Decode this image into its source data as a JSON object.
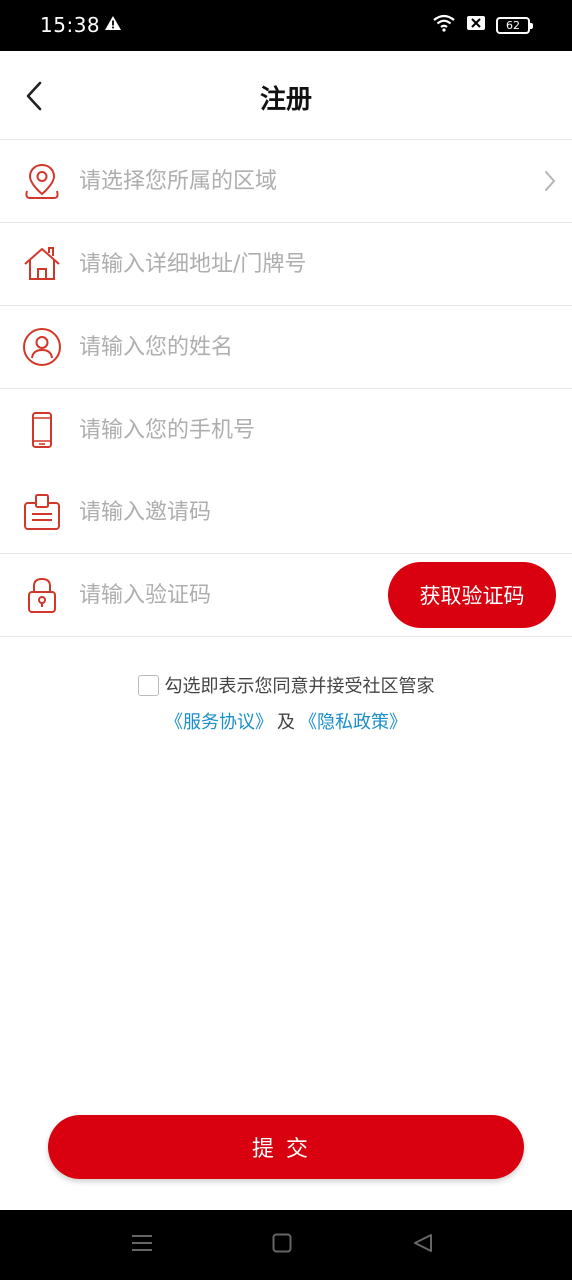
{
  "status_bar": {
    "time": "15:38",
    "battery": "62"
  },
  "header": {
    "title": "注册"
  },
  "form": {
    "region_placeholder": "请选择您所属的区域",
    "address_placeholder": "请输入详细地址/门牌号",
    "name_placeholder": "请输入您的姓名",
    "phone_placeholder": "请输入您的手机号",
    "invite_placeholder": "请输入邀请码",
    "code_placeholder": "请输入验证码",
    "get_code_label": "获取验证码"
  },
  "agreement": {
    "text": "勾选即表示您同意并接受社区管家",
    "service_link": "《服务协议》",
    "and": "及",
    "privacy_link": "《隐私政策》",
    "checked": false
  },
  "submit_label": "提交",
  "colors": {
    "accent": "#d9000f",
    "icon": "#d2382a",
    "link": "#1a8fc9",
    "placeholder": "#aeaeae"
  }
}
